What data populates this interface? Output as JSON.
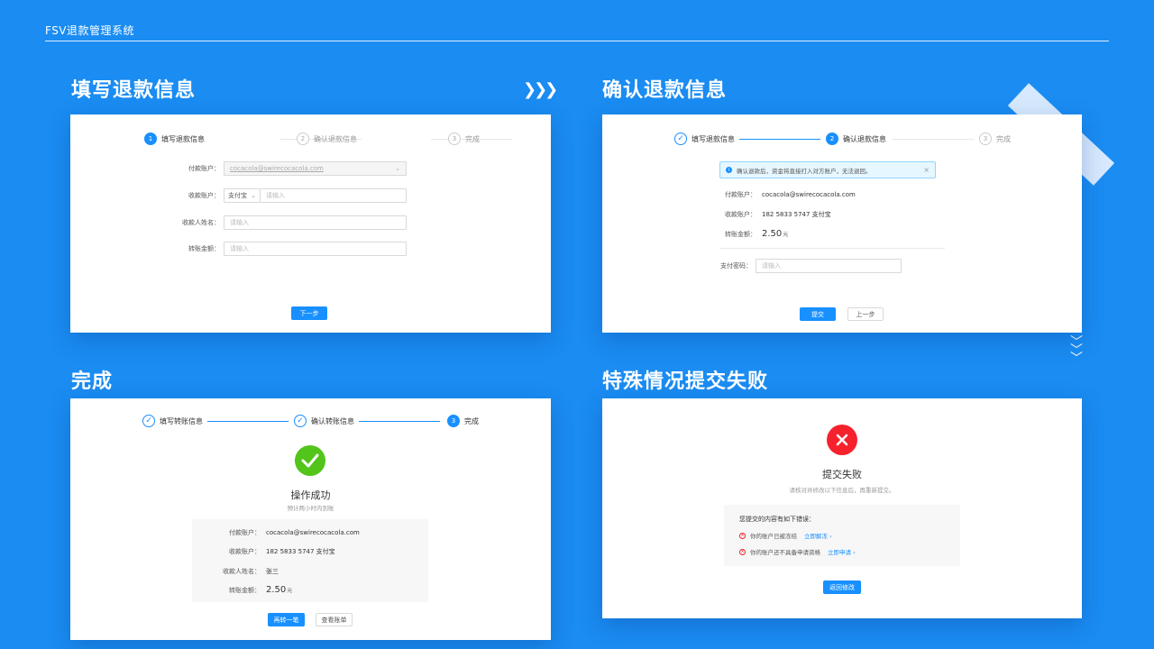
{
  "app": {
    "title": "FSV退款管理系统"
  },
  "sections": {
    "fill": "填写退款信息",
    "confirm": "确认退款信息",
    "done": "完成",
    "fail": "特殊情况提交失败"
  },
  "panel1": {
    "steps": [
      {
        "num": "1",
        "label": "填写退款信息"
      },
      {
        "num": "2",
        "label": "确认退款信息"
      },
      {
        "num": "3",
        "label": "完成"
      }
    ],
    "fields": {
      "payer_label": "付款账户：",
      "payer_value": "cocacola@swirecocacola.com",
      "payee_label": "收款账户：",
      "payee_type": "支付宝",
      "payee_placeholder": "请输入",
      "name_label": "收款人姓名：",
      "name_placeholder": "请输入",
      "amount_label": "转账金额：",
      "amount_placeholder": "请输入"
    },
    "next_button": "下一步"
  },
  "panel2": {
    "steps": [
      {
        "num": "✓",
        "label": "填写退款信息"
      },
      {
        "num": "2",
        "label": "确认退款信息"
      },
      {
        "num": "3",
        "label": "完成"
      }
    ],
    "alert": "确认退款后，资金将直接打入对方账户，无法退回。",
    "rows": {
      "payer_label": "付款账户：",
      "payer_value": "cocacola@swirecocacola.com",
      "payee_label": "收款账户：",
      "payee_value": "182 5833 5747 支付宝",
      "amount_label": "转账金额：",
      "amount_value": "2.50",
      "amount_unit": "元",
      "password_label": "支付密码：",
      "password_placeholder": "请输入"
    },
    "submit_button": "提交",
    "prev_button": "上一步"
  },
  "panel3": {
    "steps": [
      {
        "num": "✓",
        "label": "填写转账信息"
      },
      {
        "num": "✓",
        "label": "确认转账信息"
      },
      {
        "num": "3",
        "label": "完成"
      }
    ],
    "title": "操作成功",
    "subtitle": "预计两小时内到账",
    "rows": {
      "payer_label": "付款账户：",
      "payer_value": "cocacola@swirecocacola.com",
      "payee_label": "收款账户：",
      "payee_value": "182 5833 5747 支付宝",
      "name_label": "收款人姓名：",
      "name_value": "张三",
      "amount_label": "转账金额：",
      "amount_value": "2.50",
      "amount_unit": "元"
    },
    "again_button": "再转一笔",
    "bill_button": "查看账单"
  },
  "panel4": {
    "title": "提交失败",
    "subtitle": "请核对并修改以下信息后，再重新提交。",
    "errors_title": "您提交的内容有如下错误：",
    "errors": [
      {
        "text": "你的账户已被冻结",
        "action": "立即解冻"
      },
      {
        "text": "你的账户还不具备申请资格",
        "action": "立即申请"
      }
    ],
    "back_button": "返回修改"
  },
  "colors": {
    "background": "#1a8cf2",
    "primary": "#1890ff",
    "success": "#52c41a",
    "error": "#f5222d"
  }
}
